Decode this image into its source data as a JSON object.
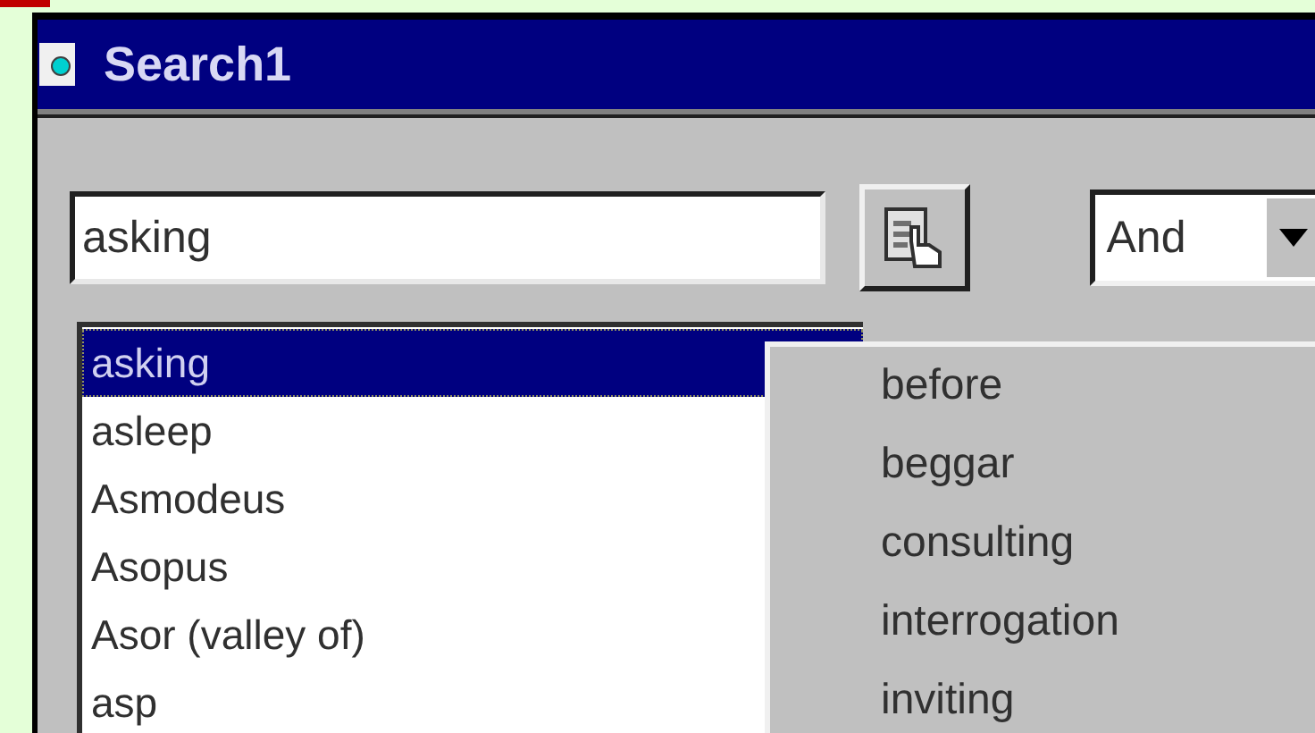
{
  "window": {
    "title": "Search1"
  },
  "search": {
    "value": "asking"
  },
  "operator": {
    "value": "And"
  },
  "word_list": [
    {
      "label": "asking",
      "selected": true
    },
    {
      "label": "asleep",
      "selected": false
    },
    {
      "label": "Asmodeus",
      "selected": false
    },
    {
      "label": "Asopus",
      "selected": false
    },
    {
      "label": "Asor (valley of)",
      "selected": false
    },
    {
      "label": "asp",
      "selected": false
    }
  ],
  "context_menu": {
    "items": [
      "before",
      "beggar",
      "consulting",
      "interrogation",
      "inviting"
    ]
  }
}
